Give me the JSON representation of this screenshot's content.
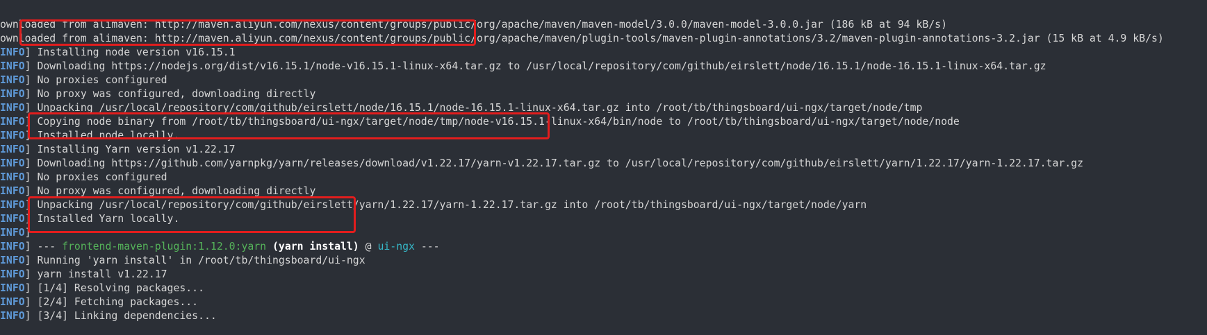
{
  "terminal": {
    "prefix_word": "INFO",
    "lines": [
      {
        "type": "plain",
        "text": "ownloaded from alimaven: http://maven.aliyun.com/nexus/content/groups/public/org/apache/maven/maven-model/3.0.0/maven-model-3.0.0.jar (186 kB at 94 kB/s)"
      },
      {
        "type": "plain",
        "text": "ownloaded from alimaven: http://maven.aliyun.com/nexus/content/groups/public/org/apache/maven/plugin-tools/maven-plugin-annotations/3.2/maven-plugin-annotations-3.2.jar (15 kB at 4.9 kB/s)"
      },
      {
        "type": "info",
        "text": " Installing node version v16.15.1"
      },
      {
        "type": "info",
        "text": " Downloading https://nodejs.org/dist/v16.15.1/node-v16.15.1-linux-x64.tar.gz to /usr/local/repository/com/github/eirslett/node/16.15.1/node-16.15.1-linux-x64.tar.gz"
      },
      {
        "type": "info",
        "text": " No proxies configured"
      },
      {
        "type": "info",
        "text": " No proxy was configured, downloading directly"
      },
      {
        "type": "info",
        "text": " Unpacking /usr/local/repository/com/github/eirslett/node/16.15.1/node-16.15.1-linux-x64.tar.gz into /root/tb/thingsboard/ui-ngx/target/node/tmp"
      },
      {
        "type": "info",
        "text": " Copying node binary from /root/tb/thingsboard/ui-ngx/target/node/tmp/node-v16.15.1-linux-x64/bin/node to /root/tb/thingsboard/ui-ngx/target/node/node"
      },
      {
        "type": "info",
        "text": " Installed node locally."
      },
      {
        "type": "info",
        "text": " Installing Yarn version v1.22.17"
      },
      {
        "type": "info",
        "text": " Downloading https://github.com/yarnpkg/yarn/releases/download/v1.22.17/yarn-v1.22.17.tar.gz to /usr/local/repository/com/github/eirslett/yarn/1.22.17/yarn-1.22.17.tar.gz"
      },
      {
        "type": "info",
        "text": " No proxies configured"
      },
      {
        "type": "info",
        "text": " No proxy was configured, downloading directly"
      },
      {
        "type": "info",
        "text": " Unpacking /usr/local/repository/com/github/eirslett/yarn/1.22.17/yarn-1.22.17.tar.gz into /root/tb/thingsboard/ui-ngx/target/node/yarn"
      },
      {
        "type": "info",
        "text": " Installed Yarn locally."
      },
      {
        "type": "info",
        "text": ""
      },
      {
        "type": "goal",
        "dashes_open": " --- ",
        "plugin": "frontend-maven-plugin:1.12.0:yarn",
        "goal": " (yarn install)",
        "at": " @ ",
        "project": "ui-ngx",
        "dashes_close": " ---"
      },
      {
        "type": "info",
        "text": " Running 'yarn install' in /root/tb/thingsboard/ui-ngx"
      },
      {
        "type": "info",
        "text": " yarn install v1.22.17"
      },
      {
        "type": "info",
        "text": " [1/4] Resolving packages..."
      },
      {
        "type": "info",
        "text": " [2/4] Fetching packages..."
      },
      {
        "type": "info",
        "text": " [3/4] Linking dependencies..."
      }
    ]
  },
  "colors": {
    "background": "#2b2f36",
    "text": "#d6d6d6",
    "info_tag": "#5f9ad8",
    "plugin": "#55b35a",
    "project": "#36b7c7",
    "highlight_box": "#e21d1d"
  }
}
